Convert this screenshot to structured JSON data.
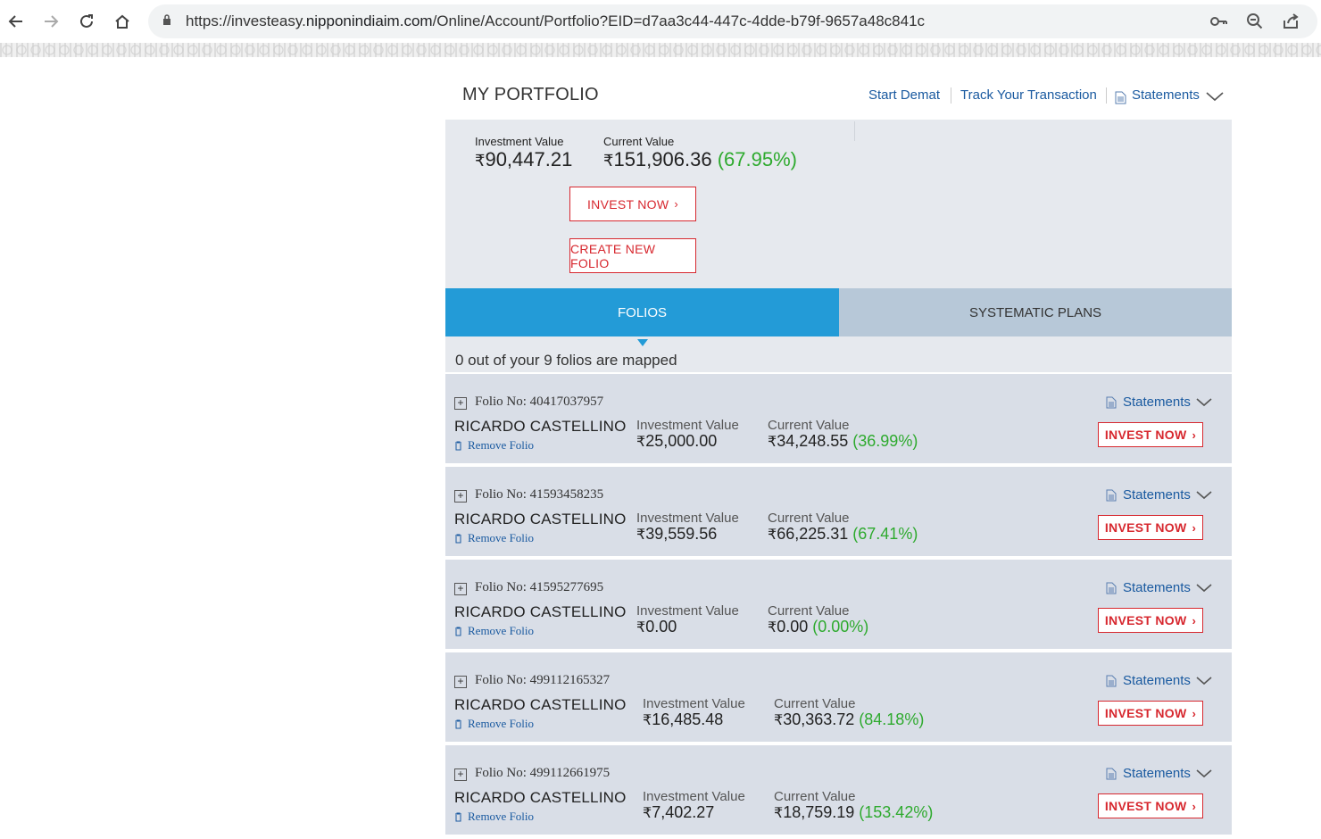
{
  "browser": {
    "url_prefix": "https://investeasy.",
    "url_domain": "nipponindiaim.com",
    "url_path": "/Online/Account/Portfolio?EID=d7aa3c44-447c-4dde-b79f-9657a48c841c",
    "icons": [
      "back-icon",
      "forward-icon",
      "reload-icon",
      "home-icon",
      "lock-icon",
      "key-icon",
      "zoom-icon",
      "share-icon"
    ]
  },
  "page": {
    "title": "MY PORTFOLIO",
    "links": {
      "start_demat": "Start Demat",
      "track": "Track Your Transaction",
      "statements": "Statements"
    }
  },
  "summary": {
    "investment_label": "Investment Value",
    "investment_value": "90,447.21",
    "current_label": "Current Value",
    "current_value": "151,906.36",
    "current_pct": "(67.95%)",
    "invest_now": "INVEST NOW",
    "create_folio": "CREATE NEW FOLIO",
    "currency": "₹"
  },
  "tabs": {
    "folios": "FOLIOS",
    "systematic": "SYSTEMATIC PLANS"
  },
  "mapped_text": "0 out of your 9 folios are mapped",
  "folio_labels": {
    "investment": "Investment Value",
    "current": "Current Value",
    "remove": "Remove Folio",
    "statements": "Statements",
    "invest": "INVEST NOW"
  },
  "folios": [
    {
      "folio": "Folio No: 40417037957",
      "holder": "RICARDO CASTELLINO",
      "investment": "25,000.00",
      "current": "34,248.55",
      "pct": "(36.99%)"
    },
    {
      "folio": "Folio No: 41593458235",
      "holder": "RICARDO CASTELLINO",
      "investment": "39,559.56",
      "current": "66,225.31",
      "pct": "(67.41%)"
    },
    {
      "folio": "Folio No: 41595277695",
      "holder": "RICARDO CASTELLINO",
      "investment": "0.00",
      "current": "0.00",
      "pct": "(0.00%)"
    },
    {
      "folio": "Folio No: 499112165327",
      "holder": "RICARDO CASTELLINO",
      "investment": "16,485.48",
      "current": "30,363.72",
      "pct": "(84.18%)"
    },
    {
      "folio": "Folio No: 499112661975",
      "holder": "RICARDO CASTELLINO",
      "investment": "7,402.27",
      "current": "18,759.19",
      "pct": "(153.42%)"
    }
  ],
  "colors": {
    "accent": "#239bd7",
    "red": "#d7282f",
    "green": "#2eaa2e",
    "link": "#1a5aa0"
  }
}
